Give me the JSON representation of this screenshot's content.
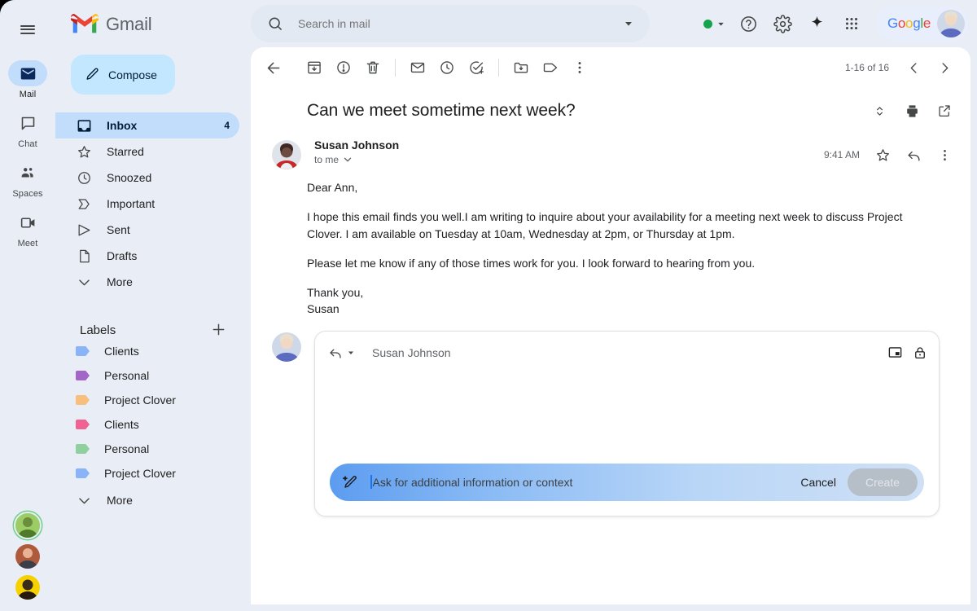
{
  "brand": {
    "name": "Gmail",
    "logo": "gmail-logo"
  },
  "compose": {
    "label": "Compose",
    "icon": "pencil-icon"
  },
  "rail": {
    "menu_icon": "hamburger-menu-icon",
    "items": [
      {
        "label": "Mail",
        "icon": "mail-icon",
        "active": true
      },
      {
        "label": "Chat",
        "icon": "chat-icon",
        "active": false
      },
      {
        "label": "Spaces",
        "icon": "spaces-icon",
        "active": false
      },
      {
        "label": "Meet",
        "icon": "meet-icon",
        "active": false
      }
    ],
    "avatars": [
      {
        "name": "contact-avatar-1",
        "color": "#7cb342",
        "ring": true
      },
      {
        "name": "contact-avatar-2",
        "color": "#a0522d",
        "ring": false
      },
      {
        "name": "contact-avatar-3",
        "color": "#f7d000",
        "ring": false
      }
    ]
  },
  "nav": {
    "items": [
      {
        "label": "Inbox",
        "icon": "inbox-icon",
        "count": "4",
        "active": true
      },
      {
        "label": "Starred",
        "icon": "star-icon",
        "count": "",
        "active": false
      },
      {
        "label": "Snoozed",
        "icon": "clock-icon",
        "count": "",
        "active": false
      },
      {
        "label": "Important",
        "icon": "important-icon",
        "count": "",
        "active": false
      },
      {
        "label": "Sent",
        "icon": "send-icon",
        "count": "",
        "active": false
      },
      {
        "label": "Drafts",
        "icon": "draft-icon",
        "count": "",
        "active": false
      },
      {
        "label": "More",
        "icon": "chevron-down-icon",
        "count": "",
        "active": false
      }
    ]
  },
  "labels": {
    "title": "Labels",
    "add_icon": "plus-icon",
    "items": [
      {
        "label": "Clients",
        "color": "#8ab4f8"
      },
      {
        "label": "Personal",
        "color": "#a365c8"
      },
      {
        "label": "Project Clover",
        "color": "#f8bf7c"
      },
      {
        "label": "Clients",
        "color": "#f06292"
      },
      {
        "label": "Personal",
        "color": "#8fd19e"
      },
      {
        "label": "Project Clover",
        "color": "#8ab4f8"
      }
    ],
    "more_label": "More",
    "more_icon": "chevron-down-icon"
  },
  "search": {
    "placeholder": "Search in mail",
    "value": "",
    "icon": "search-icon",
    "options_icon": "chevron-down-icon"
  },
  "topbar": {
    "status_icon": "status-dot-active",
    "status_color": "#14a44d",
    "status_dropdown_icon": "caret-down-icon",
    "help_icon": "help-icon",
    "settings_icon": "gear-icon",
    "gemini_icon": "sparkle-icon",
    "apps_icon": "apps-grid-icon",
    "account": {
      "logo_text": "Google",
      "avatar": "user-avatar"
    }
  },
  "toolbar": {
    "back_icon": "back-arrow-icon",
    "archive_icon": "archive-icon",
    "spam_icon": "report-spam-icon",
    "delete_icon": "trash-icon",
    "unread_icon": "mark-unread-icon",
    "snooze_icon": "snooze-clock-icon",
    "tasks_icon": "add-to-tasks-icon",
    "move_icon": "move-to-folder-icon",
    "label_icon": "label-tag-icon",
    "more_icon": "more-vertical-icon",
    "pagination": "1-16 of 16",
    "prev_icon": "chevron-left-icon",
    "next_icon": "chevron-right-icon"
  },
  "email": {
    "subject": "Can we meet sometime next week?",
    "collapse_icon": "expand-collapse-icon",
    "print_icon": "print-icon",
    "popout_icon": "open-in-new-icon",
    "sender": "Susan Johnson",
    "to_line": "to me",
    "to_expand_icon": "chevron-down-icon",
    "time": "9:41 AM",
    "star_icon": "star-icon",
    "reply_icon": "reply-icon",
    "more_icon": "more-vertical-icon",
    "avatar": "sender-avatar",
    "body": [
      "Dear Ann,",
      "I hope this email finds you well.I am writing to inquire about your availability for a meeting next week to discuss Project Clover. I am available on Tuesday at 10am, Wednesday at 2pm, or Thursday at 1pm.",
      "Please let me know if any of those times work for you. I look forward to hearing from you.",
      "Thank you,"
    ],
    "signoff": "Susan"
  },
  "reply": {
    "mode_icon": "reply-icon",
    "mode_dropdown_icon": "caret-down-icon",
    "recipient": "Susan Johnson",
    "popout_icon": "pop-out-icon",
    "confidential_icon": "lock-icon",
    "avatar": "user-avatar",
    "gemini": {
      "icon": "magic-pen-icon",
      "placeholder": "Ask for additional information or context",
      "value": "",
      "cancel_label": "Cancel",
      "create_label": "Create",
      "gradient_start": "#5c9cf0",
      "gradient_end": "#cfe0f5"
    }
  }
}
